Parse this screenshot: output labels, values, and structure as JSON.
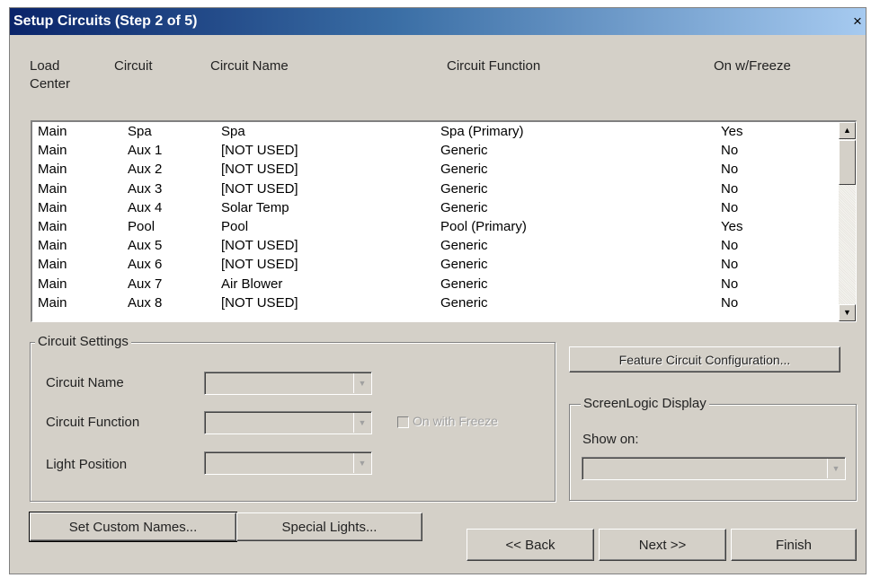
{
  "dialog": {
    "title": "Setup Circuits (Step 2 of 5)",
    "close_glyph": "×"
  },
  "columns": {
    "load_center": "Load",
    "load_center_2": "Center",
    "circuit": "Circuit",
    "circuit_name": "Circuit Name",
    "circuit_function": "Circuit Function",
    "on_freeze": "On w/Freeze"
  },
  "circuits": [
    [
      "Main",
      "Spa",
      "Spa",
      "Spa (Primary)",
      "Yes"
    ],
    [
      "Main",
      "Aux 1",
      "[NOT USED]",
      "Generic",
      "No"
    ],
    [
      "Main",
      "Aux 2",
      "[NOT USED]",
      "Generic",
      "No"
    ],
    [
      "Main",
      "Aux 3",
      "[NOT USED]",
      "Generic",
      "No"
    ],
    [
      "Main",
      "Aux 4",
      "Solar Temp",
      "Generic",
      "No"
    ],
    [
      "Main",
      "Pool",
      "Pool",
      "Pool (Primary)",
      "Yes"
    ],
    [
      "Main",
      "Aux 5",
      "[NOT USED]",
      "Generic",
      "No"
    ],
    [
      "Main",
      "Aux 6",
      "[NOT USED]",
      "Generic",
      "No"
    ],
    [
      "Main",
      "Aux 7",
      "Air Blower",
      "Generic",
      "No"
    ],
    [
      "Main",
      "Aux 8",
      "[NOT USED]",
      "Generic",
      "No"
    ]
  ],
  "circuit_settings": {
    "legend": "Circuit Settings",
    "circuit_name_label": "Circuit Name",
    "circuit_function_label": "Circuit Function",
    "light_position_label": "Light Position",
    "on_with_freeze_label": "On with Freeze"
  },
  "feature_button": "Feature Circuit Configuration...",
  "screenlogic": {
    "legend": "ScreenLogic Display",
    "show_on_label": "Show on:"
  },
  "buttons": {
    "custom_names": "Set Custom Names...",
    "special_lights": "Special Lights...",
    "back": "<< Back",
    "next": "Next >>",
    "finish": "Finish"
  },
  "icons": {
    "close": "close-icon",
    "scroll_up": "scroll-up-arrow-icon",
    "scroll_down": "scroll-down-arrow-icon",
    "dropdown": "chevron-down-icon"
  }
}
